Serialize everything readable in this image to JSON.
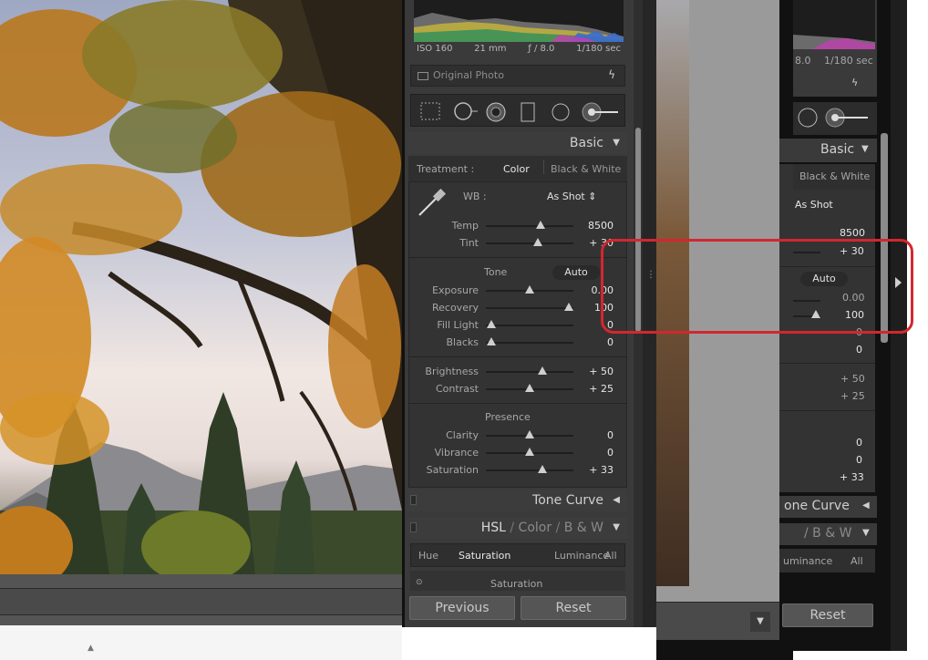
{
  "exif": {
    "iso": "ISO 160",
    "focal": "21 mm",
    "aperture": "ƒ / 8.0",
    "shutter": "1/180 sec"
  },
  "original_photo": {
    "label": "Original Photo"
  },
  "icons": {
    "crop": "crop-overlay-icon",
    "spot": "spot-removal-icon",
    "redeye": "red-eye-icon",
    "grad": "graduated-filter-icon",
    "radial": "radial-filter-icon",
    "brush": "adjustment-brush-icon",
    "eyedropper": "wb-eyedropper-icon",
    "bolt": "lightning-bolt-icon"
  },
  "basic": {
    "title": "Basic",
    "treatment_label": "Treatment :",
    "color": "Color",
    "bw": "Black & White",
    "wb_label": "WB :",
    "wb_value": "As Shot",
    "sliders_wb": [
      {
        "label": "Temp",
        "value": "8500",
        "pos": 0.62
      },
      {
        "label": "Tint",
        "value": "+ 30",
        "pos": 0.59
      }
    ],
    "tone_title": "Tone",
    "auto": "Auto",
    "sliders_tone": [
      {
        "label": "Exposure",
        "value": "0.00",
        "pos": 0.5
      },
      {
        "label": "Recovery",
        "value": "100",
        "pos": 0.95
      },
      {
        "label": "Fill Light",
        "value": "0",
        "pos": 0.06
      },
      {
        "label": "Blacks",
        "value": "0",
        "pos": 0.06
      }
    ],
    "sliders_bc": [
      {
        "label": "Brightness",
        "value": "+ 50",
        "pos": 0.65
      },
      {
        "label": "Contrast",
        "value": "+ 25",
        "pos": 0.5
      }
    ],
    "presence_title": "Presence",
    "sliders_presence": [
      {
        "label": "Clarity",
        "value": "0",
        "pos": 0.5
      },
      {
        "label": "Vibrance",
        "value": "0",
        "pos": 0.5
      },
      {
        "label": "Saturation",
        "value": "+ 33",
        "pos": 0.65
      }
    ]
  },
  "tone_curve": {
    "title": "Tone Curve"
  },
  "hsl": {
    "hsl": "HSL",
    "slash": "/",
    "color": "Color",
    "bw": "B & W",
    "tabs": [
      "Hue",
      "Saturation",
      "Luminance",
      "All"
    ],
    "sub": "Saturation"
  },
  "buttons": {
    "previous": "Previous",
    "reset": "Reset"
  },
  "zoom": {
    "exif_aperture": "8.0",
    "exif_shutter": "1/180 sec",
    "title": "Basic",
    "bw": "Black & White",
    "wb_value": "As Shot",
    "temp": "8500",
    "tint": "+ 30",
    "auto": "Auto",
    "exposure": "0.00",
    "recovery": "100",
    "fill": "0",
    "blacks": "0",
    "brightness": "+ 50",
    "contrast": "+ 25",
    "clarity": "0",
    "vibrance": "0",
    "saturation": "+ 33",
    "tone_curve": "one Curve",
    "bw2": "/ B & W",
    "luminance": "uminance",
    "all": "All",
    "reset": "Reset"
  },
  "colors": {
    "callout": "#d3272f",
    "panel": "#3a3a3a",
    "text": "#e7e7e7"
  }
}
